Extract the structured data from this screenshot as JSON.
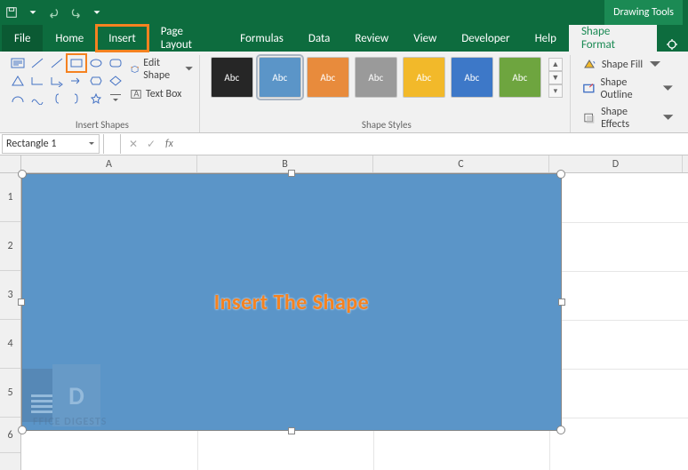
{
  "titlebar": {
    "drawing_tools_label": "Drawing Tools"
  },
  "tabs": {
    "file": "File",
    "home": "Home",
    "insert": "Insert",
    "page_layout": "Page Layout",
    "formulas": "Formulas",
    "data": "Data",
    "review": "Review",
    "view": "View",
    "developer": "Developer",
    "help": "Help",
    "shape_format": "Shape Format"
  },
  "ribbon": {
    "insert_shapes_group": "Insert Shapes",
    "shape_styles_group": "Shape Styles",
    "edit_shape": "Edit Shape",
    "text_box": "Text Box",
    "shape_fill": "Shape Fill",
    "shape_outline": "Shape Outline",
    "shape_effects": "Shape Effects",
    "style_label": "Abc",
    "style_colors": [
      "#262626",
      "#5b95c8",
      "#e88b3c",
      "#9a9a9a",
      "#f2b92a",
      "#3d78c8",
      "#6ea53f"
    ]
  },
  "namebox": {
    "value": "Rectangle 1"
  },
  "columns": [
    "A",
    "B",
    "C",
    "D"
  ],
  "rows": [
    "1",
    "2",
    "3",
    "4",
    "5",
    "6"
  ],
  "shape": {
    "caption": "Insert The Shape"
  },
  "watermark": {
    "letter": "D",
    "text": "FFICE DIGESTS"
  }
}
